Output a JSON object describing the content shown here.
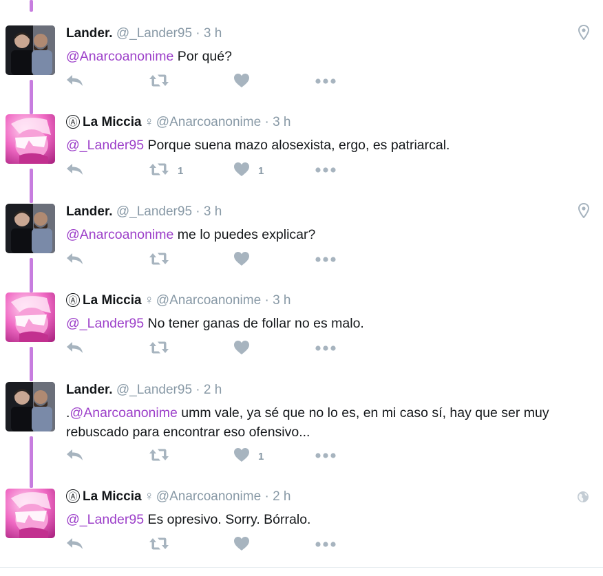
{
  "colors": {
    "mention": "#9c3fc9",
    "thread_line": "#c77ddf",
    "icon": "#a7b4bf",
    "meta": "#8899a6"
  },
  "tweets": [
    {
      "author": "Lander.",
      "handle": "@_Lander95",
      "sep": " · ",
      "time": "3 h",
      "mention": "@Anarcoanonime",
      "body": " Por qué?",
      "retweets": "",
      "likes": "",
      "corner_icon": "location-pin-icon"
    },
    {
      "author": "La Miccia",
      "symbol": "Ⓐ",
      "gender": "♀",
      "handle": "@Anarcoanonime",
      "sep": " · ",
      "time": "3 h",
      "mention": "@_Lander95",
      "body": " Porque suena mazo alosexista, ergo, es patriarcal.",
      "retweets": "1",
      "likes": "1"
    },
    {
      "author": "Lander.",
      "handle": "@_Lander95",
      "sep": " · ",
      "time": "3 h",
      "mention": "@Anarcoanonime",
      "body": " me lo puedes explicar?",
      "retweets": "",
      "likes": "",
      "corner_icon": "location-pin-icon"
    },
    {
      "author": "La Miccia",
      "symbol": "Ⓐ",
      "gender": "♀",
      "handle": "@Anarcoanonime",
      "sep": " · ",
      "time": "3 h",
      "mention": "@_Lander95",
      "body": " No tener ganas de follar no es malo.",
      "retweets": "",
      "likes": ""
    },
    {
      "author": "Lander.",
      "handle": "@_Lander95",
      "sep": " · ",
      "time": "2 h",
      "prefix": ".",
      "mention": "@Anarcoanonime",
      "body": " umm vale, ya sé que no lo es, en mi caso sí, hay que ser muy rebuscado para encontrar eso ofensivo...",
      "retweets": "",
      "likes": "1"
    },
    {
      "author": "La Miccia",
      "symbol": "Ⓐ",
      "gender": "♀",
      "handle": "@Anarcoanonime",
      "sep": " · ",
      "time": "2 h",
      "mention": "@_Lander95",
      "body": " Es opresivo. Sorry. Bórralo.",
      "retweets": "",
      "likes": "",
      "corner_icon": "globe-icon"
    }
  ]
}
